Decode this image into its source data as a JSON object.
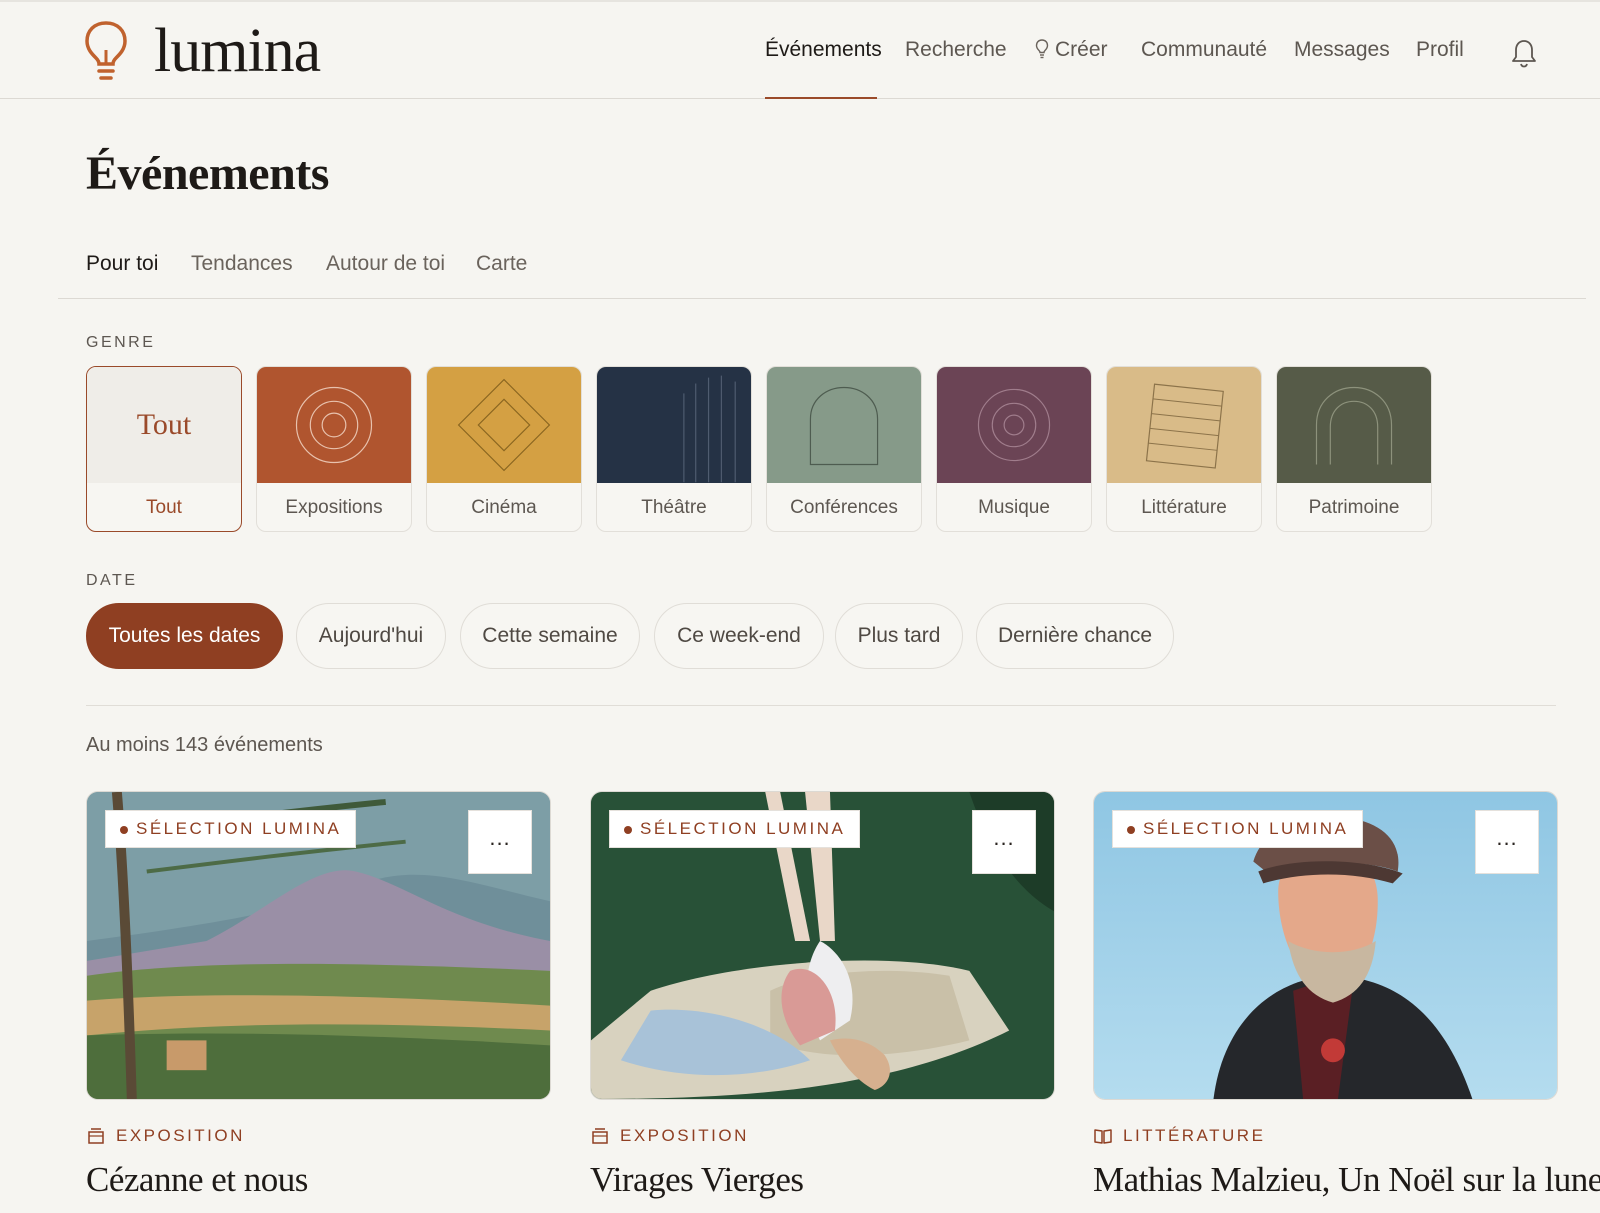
{
  "app": {
    "name": "lumina"
  },
  "nav": {
    "items": [
      {
        "label": "Événements",
        "active": true
      },
      {
        "label": "Recherche"
      },
      {
        "label": "Créer"
      },
      {
        "label": "Communauté"
      },
      {
        "label": "Messages"
      },
      {
        "label": "Profil"
      }
    ],
    "icons": {
      "create": "lightbulb-icon",
      "notifications": "bell-icon"
    }
  },
  "page": {
    "title": "Événements"
  },
  "subtabs": [
    {
      "label": "Pour toi",
      "active": true
    },
    {
      "label": "Tendances"
    },
    {
      "label": "Autour de toi"
    },
    {
      "label": "Carte"
    }
  ],
  "genre": {
    "section_label": "GENRE",
    "items": [
      {
        "label": "Tout",
        "art_text": "Tout",
        "color": "#efede8",
        "active": true
      },
      {
        "label": "Expositions",
        "color": "#b0552f"
      },
      {
        "label": "Cinéma",
        "color": "#d4a043"
      },
      {
        "label": "Théâtre",
        "color": "#253245"
      },
      {
        "label": "Conférences",
        "color": "#869a89"
      },
      {
        "label": "Musique",
        "color": "#6b4455"
      },
      {
        "label": "Littérature",
        "color": "#d9bb88"
      },
      {
        "label": "Patrimoine",
        "color": "#565b48"
      }
    ]
  },
  "date": {
    "section_label": "DATE",
    "items": [
      {
        "label": "Toutes les dates",
        "active": true
      },
      {
        "label": "Aujourd'hui"
      },
      {
        "label": "Cette semaine"
      },
      {
        "label": "Ce week-end"
      },
      {
        "label": "Plus tard"
      },
      {
        "label": "Dernière chance"
      }
    ]
  },
  "results": {
    "count_label": "Au moins 143 événements"
  },
  "cards": [
    {
      "badge": "SÉLECTION LUMINA",
      "more": "...",
      "category": "EXPOSITION",
      "category_icon": "exhibition-icon",
      "title": "Cézanne et nous"
    },
    {
      "badge": "SÉLECTION LUMINA",
      "more": "...",
      "category": "EXPOSITION",
      "category_icon": "exhibition-icon",
      "title": "Virages Vierges"
    },
    {
      "badge": "SÉLECTION LUMINA",
      "more": "...",
      "category": "LITTÉRATURE",
      "category_icon": "book-icon",
      "title": "Mathias Malzieu, Un Noël sur la lune"
    }
  ],
  "colors": {
    "accent": "#8f3f22",
    "background": "#f6f5f1"
  }
}
